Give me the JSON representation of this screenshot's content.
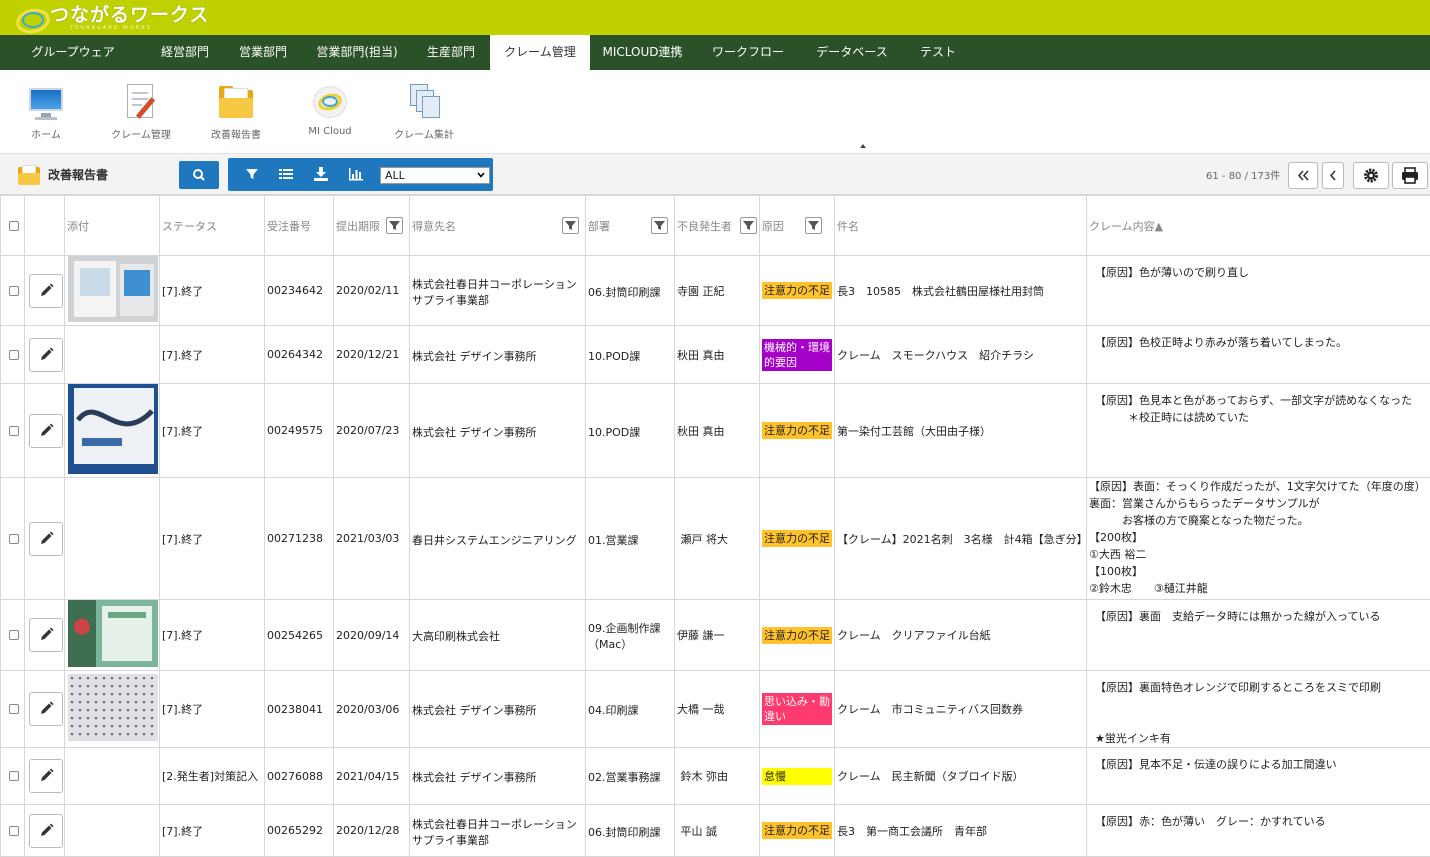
{
  "header": {
    "logo_text": "つながるワークス",
    "logo_sub": "TSUNAGARU WORKS"
  },
  "nav": {
    "tabs": [
      {
        "label": "グループウェア",
        "active": false
      },
      {
        "label": "経営部門",
        "active": false
      },
      {
        "label": "営業部門",
        "active": false
      },
      {
        "label": "営業部門(担当)",
        "active": false
      },
      {
        "label": "生産部門",
        "active": false
      },
      {
        "label": "クレーム管理",
        "active": true
      },
      {
        "label": "MICLOUD連携",
        "active": false
      },
      {
        "label": "ワークフロー",
        "active": false
      },
      {
        "label": "データベース",
        "active": false
      },
      {
        "label": "テスト",
        "active": false
      }
    ]
  },
  "shortcuts": [
    {
      "label": "ホーム",
      "icon": "monitor-icon"
    },
    {
      "label": "クレーム管理",
      "icon": "document-pen-icon"
    },
    {
      "label": "改善報告書",
      "icon": "folder-icon"
    },
    {
      "label": "MI Cloud",
      "icon": "mi-cloud-icon"
    },
    {
      "label": "クレーム集計",
      "icon": "files-icon"
    }
  ],
  "toolbar": {
    "title": "改善報告書",
    "select_value": "ALL",
    "pager_text": "61 - 80 / 173件"
  },
  "columns": {
    "attach": "添付",
    "status": "ステータス",
    "order_no": "受注番号",
    "deadline": "提出期限",
    "customer": "得意先名",
    "dept": "部署",
    "person": "不良発生者",
    "cause": "原因",
    "subject": "件名",
    "content": "クレーム内容▲"
  },
  "colors": {
    "topbar": "#bfd200",
    "nav": "#2b5129",
    "accent": "#1f77be",
    "cause_attention": "#ffc22a",
    "cause_machine": "#a400c8",
    "cause_assumption": "#ff3a6e",
    "cause_negligence": "#ffff00"
  },
  "rows": [
    {
      "thumb": "docs",
      "status": "[7].終了",
      "order_no": "00234642",
      "deadline": "2020/02/11",
      "customer": "株式会社春日井コーポレーション\nサプライ事業部",
      "dept": "06.封筒印刷課",
      "person": "寺園 正紀",
      "cause": "注意力の不足",
      "cause_type": "attention",
      "subject": "長3　10585　株式会社鶴田屋様社用封筒",
      "content": "【原因】色が薄いので刷り直し"
    },
    {
      "thumb": "",
      "status": "[7].終了",
      "order_no": "00264342",
      "deadline": "2020/12/21",
      "customer": "株式会社 デザイン事務所",
      "dept": "10.POD課",
      "person": "秋田 真由",
      "cause": "機械的・環境的要因",
      "cause_type": "machine",
      "subject": "クレーム　スモークハウス　紹介チラシ",
      "content": "【原因】色校正時より赤みが落ち着いてしまった。"
    },
    {
      "thumb": "blue",
      "status": "[7].終了",
      "order_no": "00249575",
      "deadline": "2020/07/23",
      "customer": "株式会社 デザイン事務所",
      "dept": "10.POD課",
      "person": "秋田 真由",
      "cause": "注意力の不足",
      "cause_type": "attention",
      "subject": "第一染付工芸館（大田由子様）",
      "content": "【原因】色見本と色があっておらず、一部文字が読めなくなった\n　　　＊校正時には読めていた"
    },
    {
      "thumb": "",
      "status": "[7].終了",
      "order_no": "00271238",
      "deadline": "2021/03/03",
      "customer": "春日井システムエンジニアリング",
      "dept": "01.営業課",
      "person": " 瀬戸 将大",
      "cause": "注意力の不足",
      "cause_type": "attention",
      "subject": "【クレーム】2021名刺　3名様　計4箱【急ぎ分】",
      "content": "【原因】表面：そっくり作成だったが、1文字欠けてた（年度の度）\n裏面：営業さんからもらったデータサンプルが\n　　　お客様の方で廃案となった物だった。\n【200枚】\n①大西 裕二\n【100枚】\n②鈴木忠　　③樋江井龍"
    },
    {
      "thumb": "green",
      "status": "[7].終了",
      "order_no": "00254265",
      "deadline": "2020/09/14",
      "customer": "大高印刷株式会社",
      "dept": "09.企画制作課\n（Mac）",
      "person": "伊藤 謙一",
      "cause": "注意力の不足",
      "cause_type": "attention",
      "subject": "クレーム　クリアファイル台紙",
      "content": "【原因】裏面　支給データ時には無かった線が入っている"
    },
    {
      "thumb": "pattern",
      "status": "[7].終了",
      "order_no": "00238041",
      "deadline": "2020/03/06",
      "customer": "株式会社 デザイン事務所",
      "dept": "04.印刷課",
      "person": "大橋 一哉",
      "cause": "思い込み・勘違い",
      "cause_type": "assumption",
      "subject": "クレーム　市コミュニティバス回数券",
      "content": "【原因】裏面特色オレンジで印刷するところをスミで印刷\n\n\n★蛍光インキ有"
    },
    {
      "thumb": "",
      "status": "[2.発生者]対策記入",
      "order_no": "00276088",
      "deadline": "2021/04/15",
      "customer": "株式会社 デザイン事務所",
      "dept": "02.営業事務課",
      "person": " 鈴木 弥由",
      "cause": "怠慢",
      "cause_type": "negligence",
      "subject": "クレーム　民主新聞（タブロイド版）",
      "content": "【原因】見本不足・伝達の誤りによる加工間違い"
    },
    {
      "thumb": "",
      "status": "[7].終了",
      "order_no": "00265292",
      "deadline": "2020/12/28",
      "customer": "株式会社春日井コーポレーション\nサプライ事業部",
      "dept": "06.封筒印刷課",
      "person": " 平山 誠",
      "cause": "注意力の不足",
      "cause_type": "attention",
      "subject": "長3　第一商工会議所　青年部",
      "content": "【原因】赤：色が薄い　グレー：かすれている"
    }
  ]
}
